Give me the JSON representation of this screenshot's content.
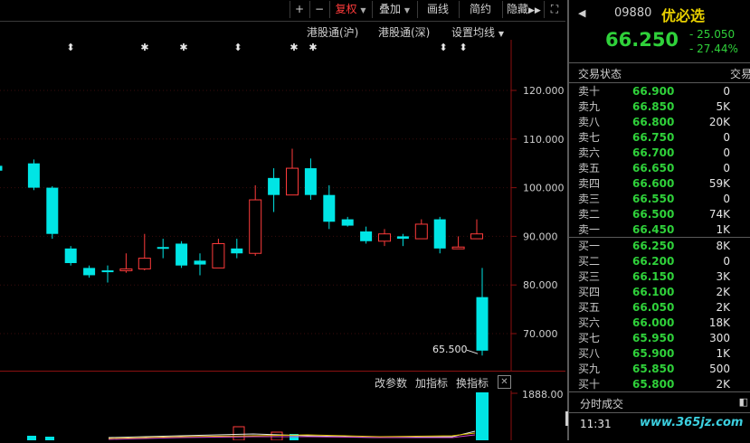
{
  "toolbar": {
    "plus": "+",
    "minus": "−",
    "fuquan": "复权",
    "diejia": "叠加",
    "huaxian": "画线",
    "jianyue": "简约",
    "yincang": "隐藏",
    "play_icon": "play-forward-icon",
    "fullscreen_icon": "expand-icon"
  },
  "subtoolbar": {
    "hk_sh": "港股通(沪)",
    "hk_sz": "港股通(深)",
    "ma_settings": "设置均线"
  },
  "price_axis": [
    "120.000",
    "110.000",
    "100.000",
    "90.000",
    "80.000",
    "70.000"
  ],
  "low_annotation": "65.500",
  "volume": {
    "change_params": "改参数",
    "add_indicator": "加指标",
    "swap_indicator": "换指标",
    "close": "✕",
    "axis_top": "1888.00"
  },
  "chart_data": {
    "type": "candlestick",
    "ylim": [
      63,
      127
    ],
    "candles": [
      {
        "o": 104.5,
        "h": 105.5,
        "l": 103.8,
        "c": 103.5,
        "dir": "down"
      },
      {
        "o": 105,
        "h": 105.8,
        "l": 99.5,
        "c": 100,
        "dir": "down"
      },
      {
        "o": 100,
        "h": 100.3,
        "l": 89.5,
        "c": 90.5,
        "dir": "down"
      },
      {
        "o": 87.5,
        "h": 88,
        "l": 84,
        "c": 84.5,
        "dir": "down"
      },
      {
        "o": 83.5,
        "h": 84,
        "l": 81.5,
        "c": 82,
        "dir": "down"
      },
      {
        "o": 83,
        "h": 84,
        "l": 80.5,
        "c": 82.8,
        "dir": "down"
      },
      {
        "o": 83,
        "h": 86.5,
        "l": 82.5,
        "c": 83.3,
        "dir": "up"
      },
      {
        "o": 83.3,
        "h": 90.5,
        "l": 83,
        "c": 85.5,
        "dir": "up"
      },
      {
        "o": 87.5,
        "h": 89.5,
        "l": 85.5,
        "c": 87.8,
        "dir": "down"
      },
      {
        "o": 88.5,
        "h": 89,
        "l": 83.5,
        "c": 84,
        "dir": "down"
      },
      {
        "o": 85,
        "h": 86.5,
        "l": 82,
        "c": 84.2,
        "dir": "down"
      },
      {
        "o": 83.5,
        "h": 89.5,
        "l": 83.5,
        "c": 88.5,
        "dir": "up"
      },
      {
        "o": 87.5,
        "h": 89.5,
        "l": 85.5,
        "c": 86.5,
        "dir": "down"
      },
      {
        "o": 86.5,
        "h": 100.5,
        "l": 86,
        "c": 97.5,
        "dir": "up"
      },
      {
        "o": 102,
        "h": 104,
        "l": 95,
        "c": 98.5,
        "dir": "down"
      },
      {
        "o": 98.5,
        "h": 108,
        "l": 98.5,
        "c": 104,
        "dir": "up"
      },
      {
        "o": 104,
        "h": 106,
        "l": 97.5,
        "c": 98.5,
        "dir": "down"
      },
      {
        "o": 98.5,
        "h": 100.5,
        "l": 91.5,
        "c": 93,
        "dir": "down"
      },
      {
        "o": 93.5,
        "h": 94,
        "l": 92,
        "c": 92.2,
        "dir": "down"
      },
      {
        "o": 91,
        "h": 92,
        "l": 88.5,
        "c": 89,
        "dir": "down"
      },
      {
        "o": 89,
        "h": 91.5,
        "l": 88,
        "c": 90.5,
        "dir": "up"
      },
      {
        "o": 90,
        "h": 90.5,
        "l": 88,
        "c": 89.5,
        "dir": "down"
      },
      {
        "o": 89.5,
        "h": 93.5,
        "l": 89.5,
        "c": 92.5,
        "dir": "up"
      },
      {
        "o": 93.5,
        "h": 94,
        "l": 86.5,
        "c": 87.5,
        "dir": "down"
      },
      {
        "o": 87.5,
        "h": 90,
        "l": 87.5,
        "c": 87.8,
        "dir": "up"
      },
      {
        "o": 89.5,
        "h": 93.5,
        "l": 89.5,
        "c": 90.5,
        "dir": "up"
      },
      {
        "o": 77.5,
        "h": 83.5,
        "l": 65.5,
        "c": 66.5,
        "dir": "down"
      }
    ]
  },
  "markers": [
    {
      "x": 78,
      "sym": "⬍"
    },
    {
      "x": 160,
      "sym": "✱"
    },
    {
      "x": 203,
      "sym": "✱"
    },
    {
      "x": 263,
      "sym": "⬍"
    },
    {
      "x": 325,
      "sym": "✱"
    },
    {
      "x": 346,
      "sym": "✱"
    },
    {
      "x": 490,
      "sym": "⬍"
    },
    {
      "x": 512,
      "sym": "⬍"
    }
  ],
  "quote": {
    "code": "09880",
    "name": "优必选",
    "price": "66.250",
    "change": "- 25.050",
    "change_pct": "- 27.44%",
    "status_label": "交易状态",
    "status_value": "交易"
  },
  "orderbook": {
    "asks": [
      {
        "label": "卖十",
        "price": "66.900",
        "vol": "0"
      },
      {
        "label": "卖九",
        "price": "66.850",
        "vol": "5K"
      },
      {
        "label": "卖八",
        "price": "66.800",
        "vol": "20K"
      },
      {
        "label": "卖七",
        "price": "66.750",
        "vol": "0"
      },
      {
        "label": "卖六",
        "price": "66.700",
        "vol": "0"
      },
      {
        "label": "卖五",
        "price": "66.650",
        "vol": "0"
      },
      {
        "label": "卖四",
        "price": "66.600",
        "vol": "59K"
      },
      {
        "label": "卖三",
        "price": "66.550",
        "vol": "0"
      },
      {
        "label": "卖二",
        "price": "66.500",
        "vol": "74K"
      },
      {
        "label": "卖一",
        "price": "66.450",
        "vol": "1K"
      }
    ],
    "bids": [
      {
        "label": "买一",
        "price": "66.250",
        "vol": "8K"
      },
      {
        "label": "买二",
        "price": "66.200",
        "vol": "0"
      },
      {
        "label": "买三",
        "price": "66.150",
        "vol": "3K"
      },
      {
        "label": "买四",
        "price": "66.100",
        "vol": "2K"
      },
      {
        "label": "买五",
        "price": "66.050",
        "vol": "2K"
      },
      {
        "label": "买六",
        "price": "66.000",
        "vol": "18K"
      },
      {
        "label": "买七",
        "price": "65.950",
        "vol": "300"
      },
      {
        "label": "买八",
        "price": "65.900",
        "vol": "1K"
      },
      {
        "label": "买九",
        "price": "65.850",
        "vol": "500"
      },
      {
        "label": "买十",
        "price": "65.800",
        "vol": "2K"
      }
    ]
  },
  "ticks": {
    "title": "分时成交",
    "time": "11:31",
    "watermark": "www.365jz.com"
  }
}
